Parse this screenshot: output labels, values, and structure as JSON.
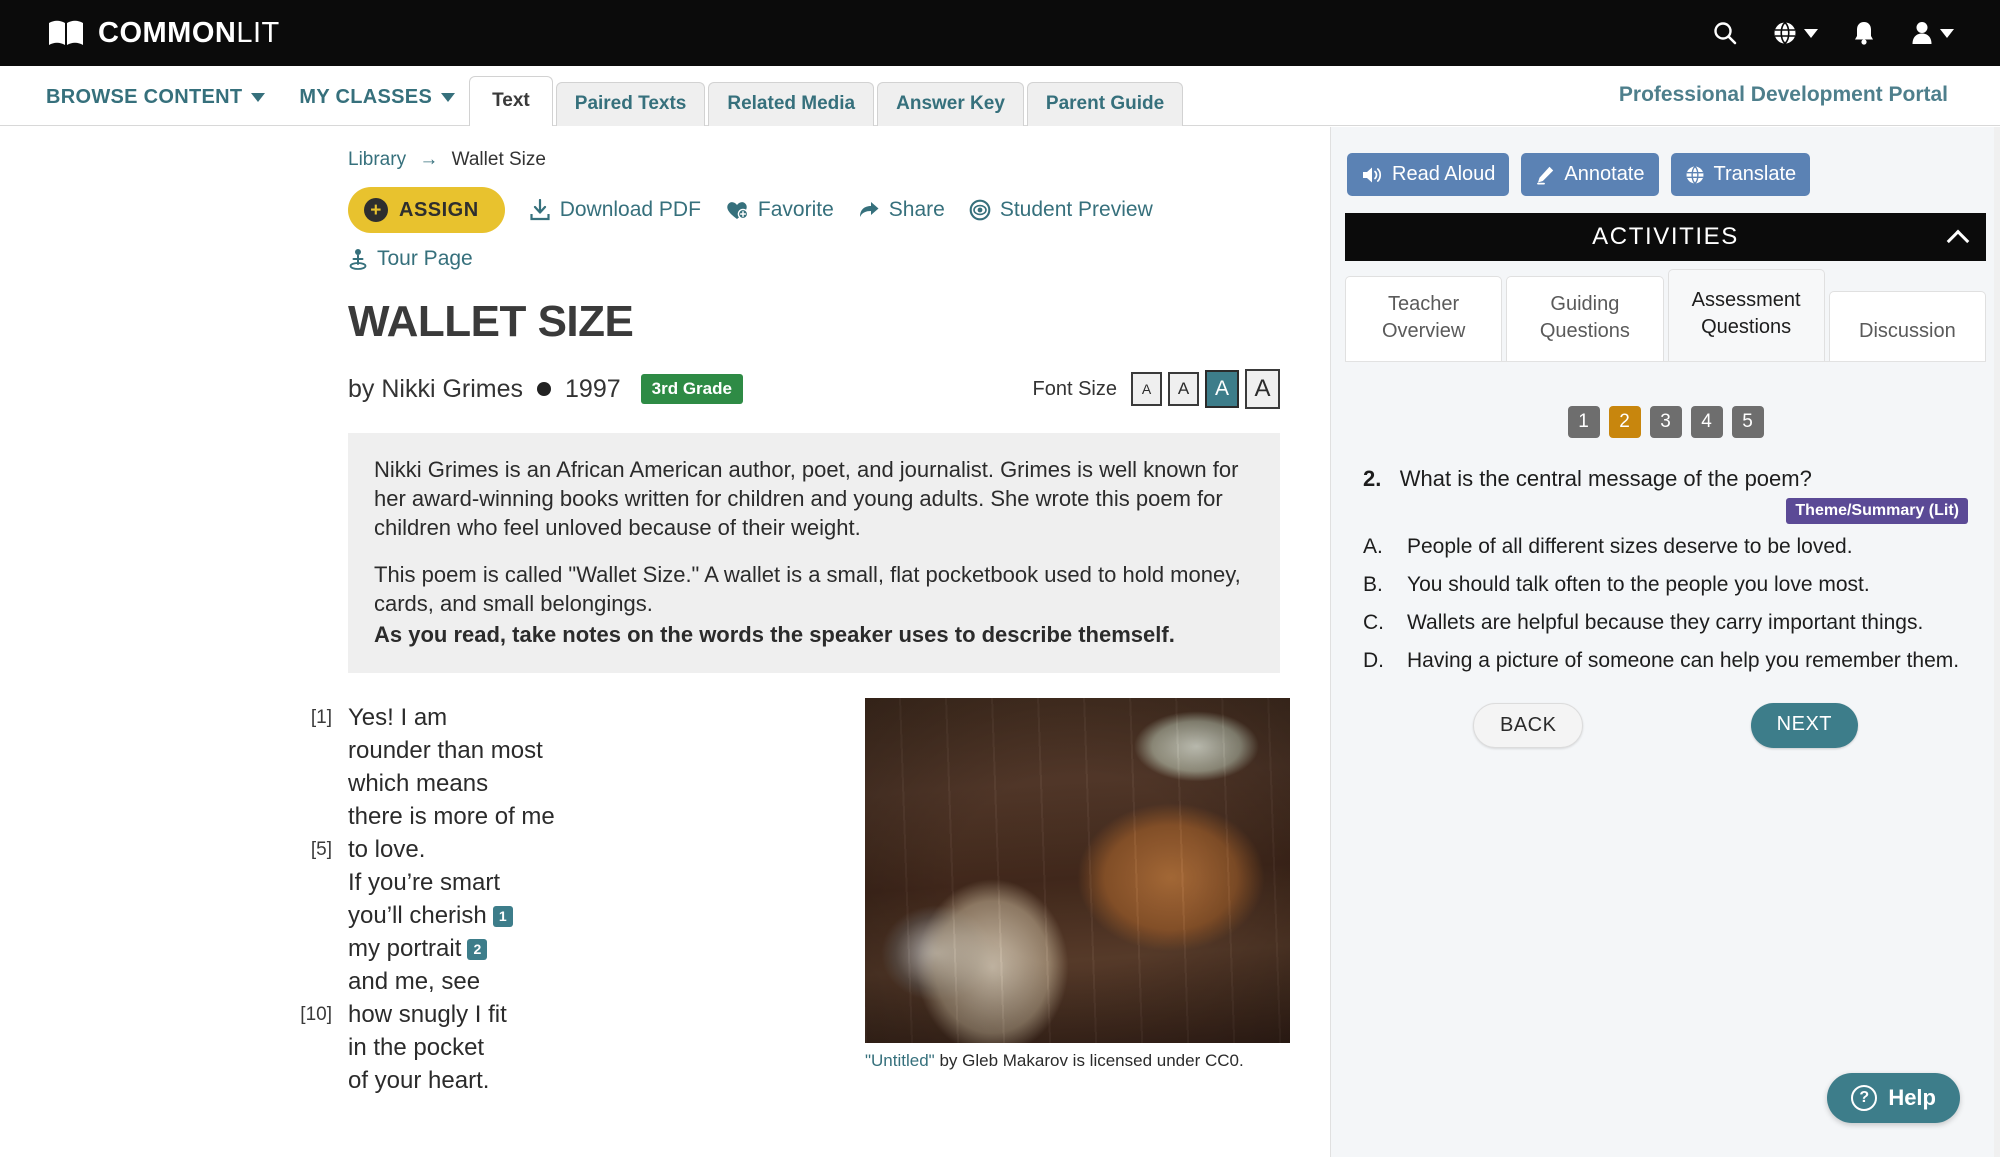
{
  "topbar": {
    "brand_main": "COMMON",
    "brand_thin": "LIT",
    "icons": {
      "search": "search-icon",
      "globe": "globe-icon",
      "bell": "bell-icon",
      "user": "user-icon"
    }
  },
  "nav": {
    "links": [
      {
        "label": "BROWSE CONTENT",
        "caret": true
      },
      {
        "label": "MY CLASSES",
        "caret": true
      }
    ],
    "tabs": [
      {
        "label": "Text",
        "active": true
      },
      {
        "label": "Paired Texts",
        "active": false
      },
      {
        "label": "Related Media",
        "active": false
      },
      {
        "label": "Answer Key",
        "active": false
      },
      {
        "label": "Parent Guide",
        "active": false
      }
    ],
    "portal_link": "Professional Development Portal"
  },
  "breadcrumb": {
    "root": "Library",
    "arrow": "→",
    "current": "Wallet Size"
  },
  "actions": {
    "assign": "ASSIGN",
    "download_pdf": "Download PDF",
    "favorite": "Favorite",
    "share": "Share",
    "student_preview": "Student Preview",
    "tour_page": "Tour Page"
  },
  "document": {
    "title": "WALLET SIZE",
    "byline": "by Nikki Grimes",
    "year": "1997",
    "grade_badge": "3rd Grade",
    "font_size_label": "Font Size",
    "font_size_options": [
      {
        "glyph": "A",
        "selected": false
      },
      {
        "glyph": "A",
        "selected": false
      },
      {
        "glyph": "A",
        "selected": true
      },
      {
        "glyph": "A",
        "selected": false
      }
    ],
    "intro": {
      "p1": "Nikki Grimes is an African American author, poet, and journalist. Grimes is well known for her award-winning books written for children and young adults. She wrote this poem for children who feel unloved because of their weight.",
      "p2": "This poem is called \"Wallet Size.\" A wallet is a small, flat pocketbook used to hold money, cards, and small belongings.",
      "p2_bold": "As you read, take notes on the words the speaker uses to describe themself."
    },
    "poem_lines": [
      {
        "num": "[1]",
        "text": "Yes! I am",
        "chip": ""
      },
      {
        "num": "",
        "text": "rounder than most",
        "chip": ""
      },
      {
        "num": "",
        "text": "which means",
        "chip": ""
      },
      {
        "num": "",
        "text": "there is more of me",
        "chip": ""
      },
      {
        "num": "[5]",
        "text": "to love.",
        "chip": ""
      },
      {
        "num": "",
        "text": "If you’re smart",
        "chip": ""
      },
      {
        "num": "",
        "text": "you’ll cherish",
        "chip": "1"
      },
      {
        "num": "",
        "text": "my portrait",
        "chip": "2"
      },
      {
        "num": "",
        "text": "and me, see",
        "chip": ""
      },
      {
        "num": "[10]",
        "text": "how snugly I fit",
        "chip": ""
      },
      {
        "num": "",
        "text": "in the pocket",
        "chip": ""
      },
      {
        "num": "",
        "text": "of your heart.",
        "chip": ""
      }
    ],
    "figure": {
      "alt": "brown-leather-wallet-photos-envelope-dollar-bills-on-wood-table",
      "caption_link": "\"Untitled\"",
      "caption_rest": " by Gleb Makarov is licensed under CC0."
    }
  },
  "right_panel": {
    "tools": [
      {
        "label": "Read Aloud",
        "icon": "speaker-icon"
      },
      {
        "label": "Annotate",
        "icon": "highlighter-icon"
      },
      {
        "label": "Translate",
        "icon": "globe-icon"
      }
    ],
    "activities_header": "ACTIVITIES",
    "activity_tabs": [
      {
        "label_line1": "Teacher",
        "label_line2": "Overview",
        "active": false
      },
      {
        "label_line1": "Guiding",
        "label_line2": "Questions",
        "active": false
      },
      {
        "label_line1": "Assessment",
        "label_line2": "Questions",
        "active": true
      },
      {
        "label_line1": "Discussion",
        "label_line2": "",
        "active": false
      }
    ],
    "question_nav": [
      {
        "label": "1",
        "active": false
      },
      {
        "label": "2",
        "active": true
      },
      {
        "label": "3",
        "active": false
      },
      {
        "label": "4",
        "active": false
      },
      {
        "label": "5",
        "active": false
      }
    ],
    "question": {
      "number": "2.",
      "prompt": "What is the central message of the poem?",
      "tag": "Theme/Summary (Lit)",
      "choices": [
        {
          "letter": "A.",
          "text": "People of all different sizes deserve to be loved."
        },
        {
          "letter": "B.",
          "text": "You should talk often to the people you love most."
        },
        {
          "letter": "C.",
          "text": "Wallets are helpful because they carry important things."
        },
        {
          "letter": "D.",
          "text": "Having a picture of someone can help you remember them."
        }
      ]
    },
    "back_label": "BACK",
    "next_label": "NEXT"
  },
  "help_widget": {
    "label": "Help",
    "icon": "question-mark-icon"
  },
  "colors": {
    "brand_black": "#0b0b0b",
    "teal": "#36707c",
    "assign_yellow": "#e8c22e",
    "grade_green": "#2e8b45",
    "tool_blue": "#5b82b4",
    "active_question_orange": "#c8860d",
    "tag_purple": "#5b4a96",
    "next_teal": "#3d7d8a"
  }
}
